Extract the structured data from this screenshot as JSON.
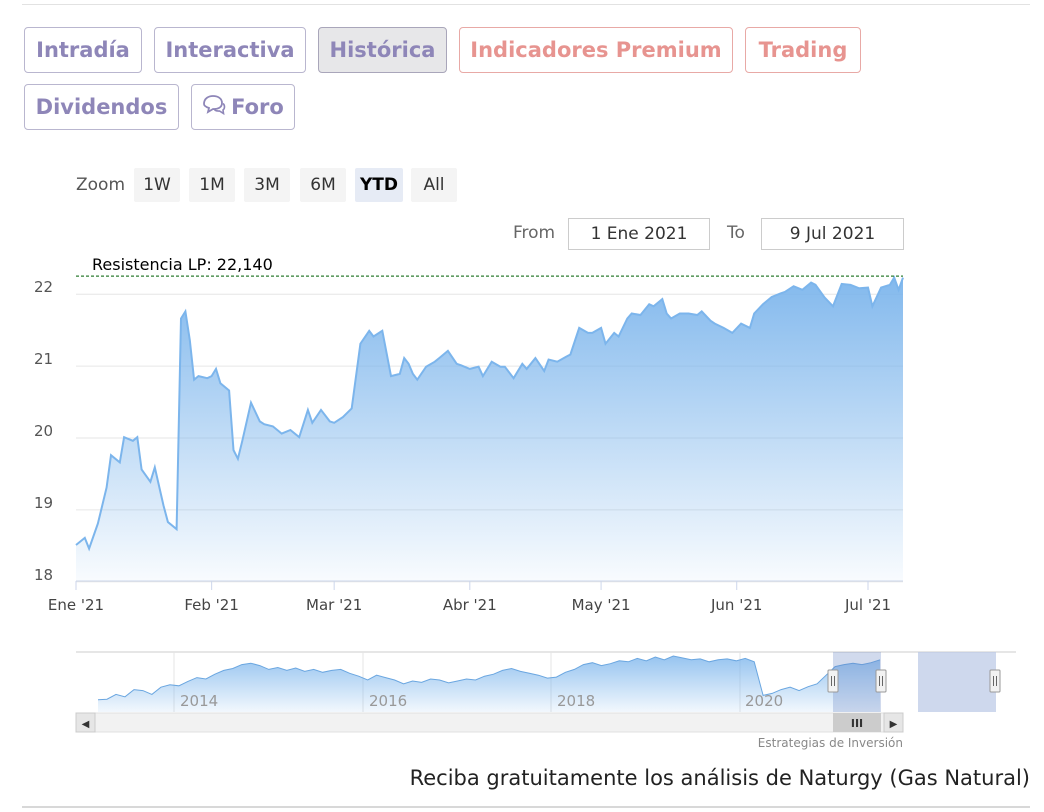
{
  "tabs": {
    "intradia": "Intradía",
    "interactiva": "Interactiva",
    "historica": "Histórica",
    "premium": "Indicadores Premium",
    "trading": "Trading",
    "dividendos": "Dividendos",
    "foro": "Foro"
  },
  "range_selector": {
    "zoom_label": "Zoom",
    "buttons": [
      "1W",
      "1M",
      "3M",
      "6M",
      "YTD",
      "All"
    ],
    "selected": "YTD",
    "from_label": "From",
    "from_value": "1 Ene 2021",
    "to_label": "To",
    "to_value": "9 Jul 2021"
  },
  "colors": {
    "line": "#7cb5ec",
    "tab_text": "#8e86b8",
    "premium_text": "#e79490",
    "resistance": "#2e7d32"
  },
  "chart_data": {
    "type": "area",
    "title": "",
    "ylim": [
      17.9,
      22.1
    ],
    "yticks": [
      18,
      19,
      20,
      21,
      22
    ],
    "xlim": [
      "2021-01-01",
      "2021-07-09"
    ],
    "xticks": [
      {
        "date": "2021-01-01",
        "label": "Ene '21"
      },
      {
        "date": "2021-02-01",
        "label": "Feb '21"
      },
      {
        "date": "2021-03-01",
        "label": "Mar '21"
      },
      {
        "date": "2021-04-01",
        "label": "Abr '21"
      },
      {
        "date": "2021-05-01",
        "label": "May '21"
      },
      {
        "date": "2021-06-01",
        "label": "Jun '21"
      },
      {
        "date": "2021-07-01",
        "label": "Jul '21"
      }
    ],
    "resistance": {
      "label": "Resistencia LP: 22,140",
      "value": 22.14
    },
    "series": [
      {
        "x": [
          "2021-01-01",
          "2021-01-03",
          "2021-01-04",
          "2021-01-06",
          "2021-01-08",
          "2021-01-09",
          "2021-01-11",
          "2021-01-12",
          "2021-01-14",
          "2021-01-15",
          "2021-01-16",
          "2021-01-18",
          "2021-01-19",
          "2021-01-21",
          "2021-01-22",
          "2021-01-24",
          "2021-01-25",
          "2021-01-26",
          "2021-01-27",
          "2021-01-28",
          "2021-01-29",
          "2021-01-31",
          "2021-02-01",
          "2021-02-02",
          "2021-02-03",
          "2021-02-05",
          "2021-02-06",
          "2021-02-07",
          "2021-02-08",
          "2021-02-10",
          "2021-02-12",
          "2021-02-13",
          "2021-02-15",
          "2021-02-17",
          "2021-02-19",
          "2021-02-21",
          "2021-02-23",
          "2021-02-24",
          "2021-02-26",
          "2021-02-28",
          "2021-03-01",
          "2021-03-03",
          "2021-03-05",
          "2021-03-07",
          "2021-03-09",
          "2021-03-10",
          "2021-03-12",
          "2021-03-14",
          "2021-03-16",
          "2021-03-17",
          "2021-03-18",
          "2021-03-19",
          "2021-03-20",
          "2021-03-22",
          "2021-03-24",
          "2021-03-25",
          "2021-03-27",
          "2021-03-29",
          "2021-03-30",
          "2021-04-01",
          "2021-04-03",
          "2021-04-04",
          "2021-04-06",
          "2021-04-08",
          "2021-04-09",
          "2021-04-11",
          "2021-04-13",
          "2021-04-14",
          "2021-04-16",
          "2021-04-18",
          "2021-04-19",
          "2021-04-21",
          "2021-04-23",
          "2021-04-24",
          "2021-04-26",
          "2021-04-28",
          "2021-04-29",
          "2021-05-01",
          "2021-05-02",
          "2021-05-04",
          "2021-05-05",
          "2021-05-07",
          "2021-05-08",
          "2021-05-10",
          "2021-05-12",
          "2021-05-13",
          "2021-05-15",
          "2021-05-16",
          "2021-05-17",
          "2021-05-19",
          "2021-05-21",
          "2021-05-23",
          "2021-05-24",
          "2021-05-26",
          "2021-05-27",
          "2021-05-29",
          "2021-05-31",
          "2021-06-02",
          "2021-06-04",
          "2021-06-05",
          "2021-06-07",
          "2021-06-09",
          "2021-06-11",
          "2021-06-12",
          "2021-06-14",
          "2021-06-16",
          "2021-06-18",
          "2021-06-19",
          "2021-06-21",
          "2021-06-23",
          "2021-06-25",
          "2021-06-27",
          "2021-06-29",
          "2021-07-01",
          "2021-07-02",
          "2021-07-04",
          "2021-07-06",
          "2021-07-07",
          "2021-07-08",
          "2021-07-09"
        ],
        "y": [
          18.4,
          18.5,
          18.35,
          18.7,
          19.2,
          19.65,
          19.55,
          19.9,
          19.85,
          19.9,
          19.45,
          19.28,
          19.48,
          18.95,
          18.72,
          18.62,
          21.55,
          21.65,
          21.25,
          20.7,
          20.75,
          20.72,
          20.75,
          20.85,
          20.65,
          20.55,
          19.72,
          19.6,
          19.85,
          20.38,
          20.12,
          20.08,
          20.05,
          19.95,
          20.0,
          19.9,
          20.28,
          20.1,
          20.28,
          20.12,
          20.1,
          20.18,
          20.3,
          21.2,
          21.38,
          21.3,
          21.38,
          20.75,
          20.78,
          21.0,
          20.92,
          20.78,
          20.7,
          20.88,
          20.95,
          21.0,
          21.1,
          20.92,
          20.9,
          20.85,
          20.88,
          20.75,
          20.95,
          20.88,
          20.88,
          20.72,
          20.92,
          20.85,
          21.0,
          20.82,
          20.98,
          20.95,
          21.02,
          21.05,
          21.42,
          21.35,
          21.35,
          21.42,
          21.2,
          21.35,
          21.3,
          21.55,
          21.62,
          21.6,
          21.75,
          21.72,
          21.82,
          21.62,
          21.55,
          21.62,
          21.62,
          21.6,
          21.65,
          21.52,
          21.48,
          21.42,
          21.35,
          21.48,
          21.42,
          21.62,
          21.75,
          21.85,
          21.9,
          21.92,
          22.0,
          21.95,
          22.05,
          22.02,
          21.85,
          21.72,
          22.03,
          22.02,
          21.97,
          21.98,
          21.72,
          21.98,
          22.02,
          22.12,
          21.95,
          22.12
        ]
      }
    ]
  },
  "navigator": {
    "labels": [
      "2014",
      "2016",
      "2018",
      "2020"
    ],
    "scroll_glyph": "III",
    "scroll_left_glyph": "◀",
    "scroll_right_glyph": "▶",
    "series": [
      0.09,
      0.1,
      0.2,
      0.15,
      0.3,
      0.28,
      0.2,
      0.35,
      0.4,
      0.38,
      0.47,
      0.55,
      0.52,
      0.62,
      0.7,
      0.74,
      0.82,
      0.85,
      0.8,
      0.72,
      0.76,
      0.7,
      0.75,
      0.68,
      0.72,
      0.66,
      0.7,
      0.72,
      0.64,
      0.58,
      0.5,
      0.6,
      0.55,
      0.5,
      0.42,
      0.48,
      0.45,
      0.52,
      0.5,
      0.44,
      0.48,
      0.52,
      0.5,
      0.58,
      0.62,
      0.7,
      0.74,
      0.68,
      0.64,
      0.6,
      0.54,
      0.56,
      0.66,
      0.72,
      0.82,
      0.86,
      0.8,
      0.84,
      0.9,
      0.88,
      0.95,
      0.9,
      0.98,
      0.92,
      1.0,
      0.96,
      0.92,
      0.94,
      0.88,
      0.92,
      0.94,
      0.9,
      0.95,
      0.88,
      0.18,
      0.22,
      0.3,
      0.35,
      0.28,
      0.36,
      0.42,
      0.6,
      0.78,
      0.82,
      0.85,
      0.82,
      0.86,
      0.92
    ]
  },
  "footer": {
    "credit": "Estrategias de Inversión",
    "cta": "Reciba gratuitamente los análisis de Naturgy (Gas Natural)"
  }
}
